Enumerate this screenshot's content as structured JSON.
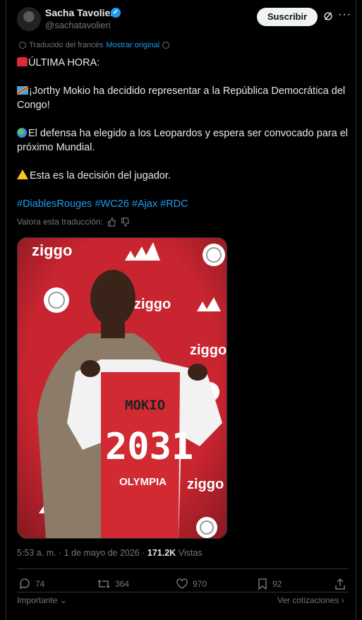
{
  "author": {
    "name": "Sacha Tavolieri",
    "handle": "@sachatavolieri",
    "verified_icon": "verified-badge-icon"
  },
  "header": {
    "follow_label": "Suscribir",
    "more_label": "···"
  },
  "translation": {
    "note": "Traducido del francés",
    "show_original": "Mostrar original"
  },
  "post": {
    "line1": "ÚLTIMA HORA:",
    "line2": "¡Jorthy Mokio ha decidido representar a la República Democrática del Congo!",
    "line3": "El defensa ha elegido a los Leopardos y espera ser convocado para el próximo Mundial.",
    "line4": "Esta es la decisión del jugador.",
    "hashtags": [
      "#DiablesRouges",
      "#WC26",
      "#Ajax",
      "#RDC"
    ]
  },
  "rate_translation": "Valora esta traducción:",
  "photo": {
    "sponsor": "ziggo",
    "jersey_name": "MOKIO",
    "jersey_number": "2031",
    "kit_brand": "OLYMPIA"
  },
  "meta": {
    "time": "5:53 a. m.",
    "sep": "·",
    "date": "1 de mayo de 2026",
    "views_count": "171.2K",
    "views_label": "Vistas"
  },
  "actions": {
    "replies": "74",
    "reposts": "364",
    "likes": "970",
    "bookmarks": "92"
  },
  "footer": {
    "sort_label": "Importante",
    "quotes_label": "Ver cotizaciones"
  },
  "colors": {
    "background": "#000000",
    "text": "#e7e9ea",
    "muted": "#71767b",
    "accent": "#1d9bf0",
    "divider": "#2f3336"
  }
}
